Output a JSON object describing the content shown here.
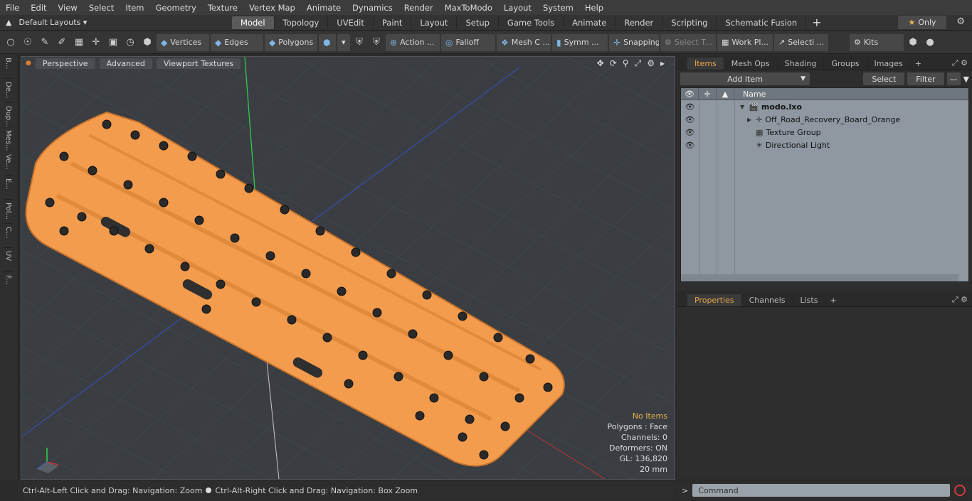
{
  "menu": [
    "File",
    "Edit",
    "View",
    "Select",
    "Item",
    "Geometry",
    "Texture",
    "Vertex Map",
    "Animate",
    "Dynamics",
    "Render",
    "MaxToModo",
    "Layout",
    "System",
    "Help"
  ],
  "layouts_label": "Default Layouts",
  "tabs": [
    {
      "label": "Model",
      "active": true
    },
    {
      "label": "Topology"
    },
    {
      "label": "UVEdit"
    },
    {
      "label": "Paint"
    },
    {
      "label": "Layout"
    },
    {
      "label": "Setup"
    },
    {
      "label": "Game Tools"
    },
    {
      "label": "Animate"
    },
    {
      "label": "Render"
    },
    {
      "label": "Scripting"
    },
    {
      "label": "Schematic Fusion"
    }
  ],
  "only_label": "Only",
  "toolbar": {
    "vertices": "Vertices",
    "edges": "Edges",
    "polygons": "Polygons",
    "action": "Action ...",
    "falloff": "Falloff",
    "mesh": "Mesh C ...",
    "symm": "Symm ...",
    "snapping": "Snapping",
    "select_t": "Select T...",
    "work_pl": "Work Pl...",
    "selecti": "Selecti ...",
    "kits": "Kits"
  },
  "left_tabs": [
    "B...",
    "De...",
    "Dup...",
    "Mes...",
    "Ve...",
    "E...",
    "Pol...",
    "C...",
    "UV",
    "F..."
  ],
  "viewport": {
    "perspective": "Perspective",
    "advanced": "Advanced",
    "textures": "Viewport Textures",
    "stats": {
      "no_items": "No Items",
      "polygons": "Polygons : Face",
      "channels": "Channels: 0",
      "deformers": "Deformers: ON",
      "gl": "GL: 136,820",
      "size": "20 mm"
    }
  },
  "status": {
    "left": "Ctrl-Alt-Left Click and Drag: Navigation: Zoom",
    "right": "Ctrl-Alt-Right Click and Drag: Navigation: Box Zoom"
  },
  "items_panel": {
    "tabs": [
      "Items",
      "Mesh Ops",
      "Shading",
      "Groups",
      "Images"
    ],
    "add_item": "Add Item",
    "select": "Select",
    "filter": "Filter",
    "name_header": "Name",
    "rows": [
      {
        "label": "modo.lxo"
      },
      {
        "label": "Off_Road_Recovery_Board_Orange"
      },
      {
        "label": "Texture Group"
      },
      {
        "label": "Directional Light"
      }
    ]
  },
  "props_panel": {
    "tabs": [
      "Properties",
      "Channels",
      "Lists"
    ]
  },
  "command": {
    "placeholder": "Command"
  },
  "colors": {
    "accent": "#e8a54a",
    "board": "#f39c4e",
    "viewport_bg": "#3a3e43"
  }
}
